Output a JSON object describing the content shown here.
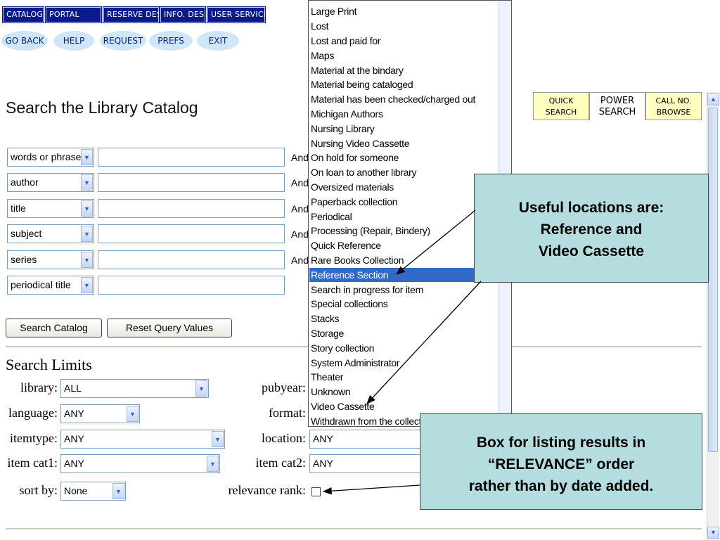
{
  "nav": {
    "tabs": [
      "CATALOG",
      "PORTAL",
      "RESERVE DESK",
      "INFO. DESK",
      "USER SERVICES"
    ],
    "buttons": [
      "GO BACK",
      "HELP",
      "REQUEST",
      "PREFS",
      "EXIT"
    ]
  },
  "page_title": "Search the Library Catalog",
  "search_rows": [
    {
      "field": "words or phrase",
      "op": "And"
    },
    {
      "field": "author",
      "op": "And"
    },
    {
      "field": "title",
      "op": "And"
    },
    {
      "field": "subject",
      "op": "And"
    },
    {
      "field": "series",
      "op": "And"
    },
    {
      "field": "periodical title",
      "op": ""
    }
  ],
  "actions": {
    "search": "Search Catalog",
    "reset": "Reset Query Values"
  },
  "limits": {
    "title": "Search Limits",
    "library_label": "library:",
    "library_value": "ALL",
    "language_label": "language:",
    "language_value": "ANY",
    "itemtype_label": "itemtype:",
    "itemtype_value": "ANY",
    "itemcat1_label": "item cat1:",
    "itemcat1_value": "ANY",
    "sortby_label": "sort by:",
    "sortby_value": "None",
    "pubyear_label": "pubyear:",
    "format_label": "format:",
    "location_label": "location:",
    "location_value": "ANY",
    "itemcat2_label": "item cat2:",
    "itemcat2_value": "ANY",
    "relevance_label": "relevance rank:"
  },
  "dropdown": {
    "items": [
      "Large Print",
      "Lost",
      "Lost and paid for",
      "Maps",
      "Material at the bindary",
      "Material being cataloged",
      "Material has been checked/charged out",
      "Michigan Authors",
      "Nursing Library",
      "Nursing Video Cassette",
      "On hold for someone",
      "On loan to another library",
      "Oversized materials",
      "Paperback collection",
      "Periodical",
      "Processing (Repair, Bindery)",
      "Quick Reference",
      "Rare Books Collection",
      "Reference Section",
      "Search in progress for item",
      "Special collections",
      "Stacks",
      "Storage",
      "Story collection",
      "System Administrator",
      "Theater",
      "Unknown",
      "Video Cassette",
      "Withdrawn from the collect"
    ],
    "selected": "Reference Section"
  },
  "right_tabs": [
    {
      "line1": "QUICK",
      "line2": "SEARCH"
    },
    {
      "line1": "POWER",
      "line2": "SEARCH"
    },
    {
      "line1": "CALL NO.",
      "line2": "BROWSE"
    }
  ],
  "callouts": {
    "useful": [
      "Useful locations are:",
      "Reference and",
      "Video Cassette"
    ],
    "relevance": [
      "Box for listing results in",
      "“RELEVANCE” order",
      "rather than by date added."
    ]
  },
  "colors": {
    "nav_bg": "#0a1a8c",
    "callout_bg": "#b5dde0",
    "selected_bg": "#3169c6"
  }
}
